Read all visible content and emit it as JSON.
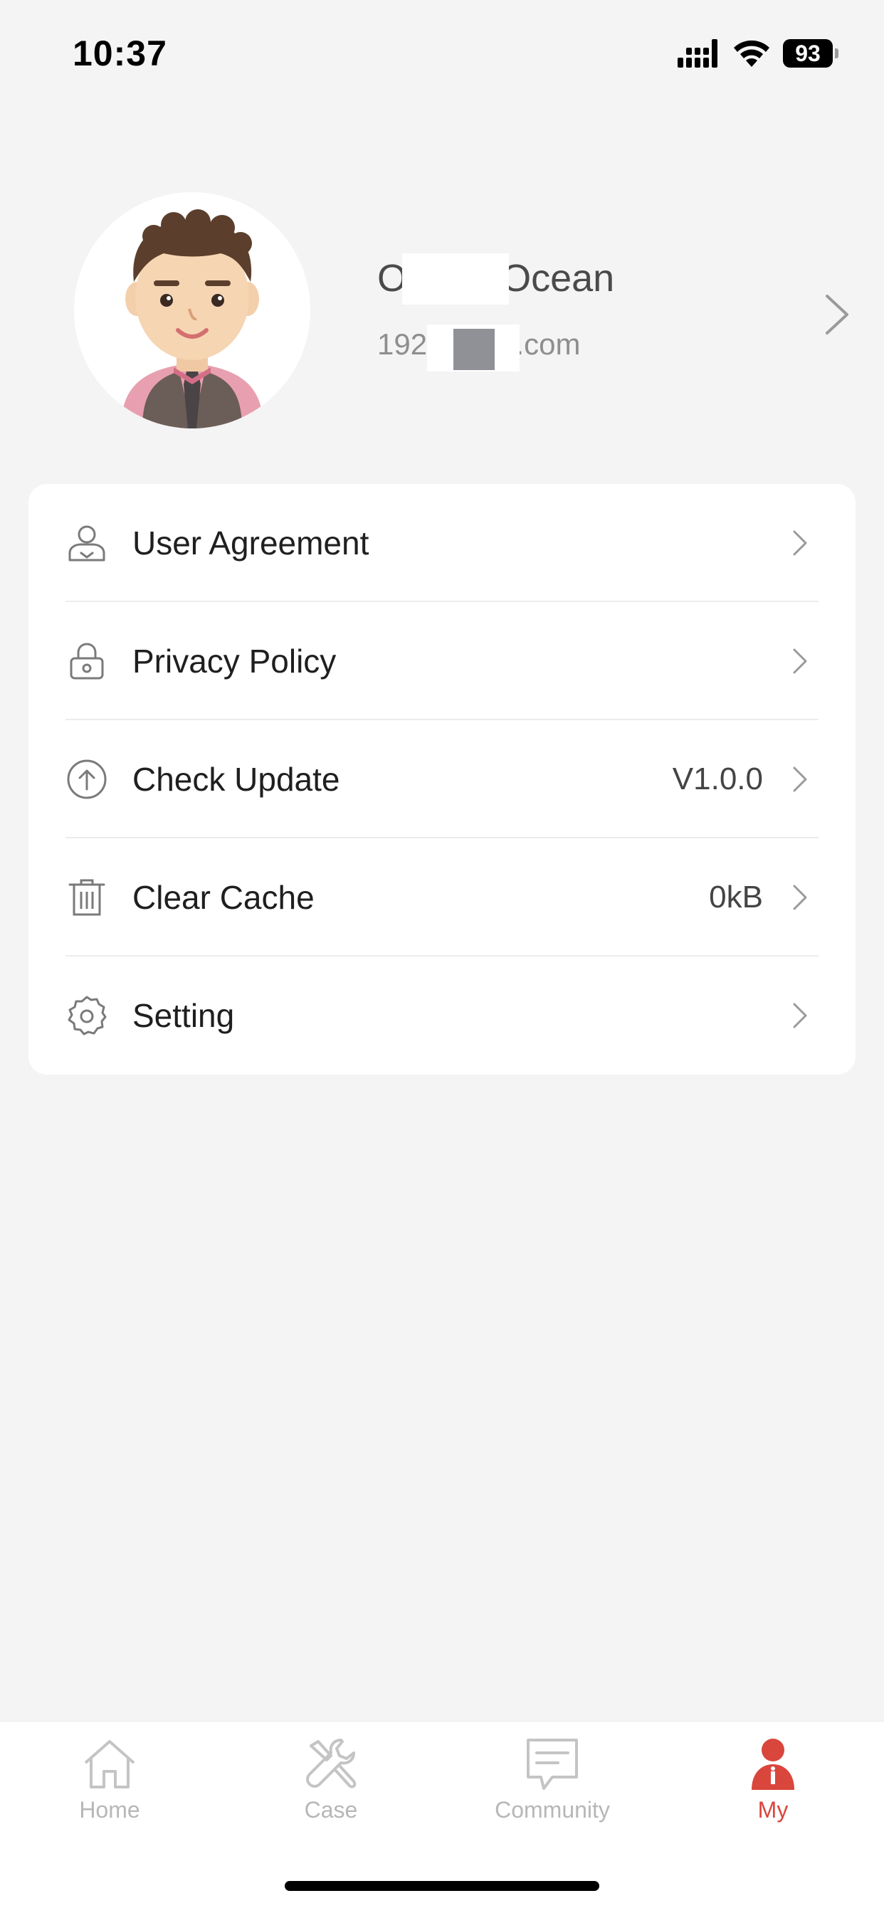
{
  "status_bar": {
    "time": "10:37",
    "battery": "93"
  },
  "profile": {
    "name": "Ocean Ocean",
    "email": "1928 @qq.com"
  },
  "menu": [
    {
      "label": "User Agreement",
      "value": "",
      "icon": "user-icon"
    },
    {
      "label": "Privacy Policy",
      "value": "",
      "icon": "lock-icon"
    },
    {
      "label": "Check Update",
      "value": "V1.0.0",
      "icon": "upload-arrow-icon"
    },
    {
      "label": "Clear Cache",
      "value": "0kB",
      "icon": "trash-icon"
    },
    {
      "label": "Setting",
      "value": "",
      "icon": "gear-icon"
    }
  ],
  "tabs": [
    {
      "label": "Home",
      "icon": "home-icon",
      "active": false
    },
    {
      "label": "Case",
      "icon": "wrench-icon",
      "active": false
    },
    {
      "label": "Community",
      "icon": "message-icon",
      "active": false
    },
    {
      "label": "My",
      "icon": "person-icon",
      "active": true
    }
  ],
  "colors": {
    "background": "#f4f4f4",
    "accent": "#d9463c",
    "inactive_tab": "#b7b7b7"
  }
}
